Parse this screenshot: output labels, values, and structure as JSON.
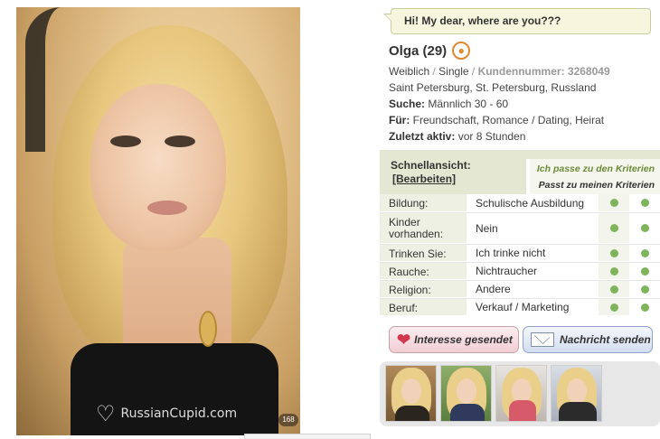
{
  "message": {
    "text": "Hi! My dear, where are you???"
  },
  "profile": {
    "name": "Olga (29)",
    "gender": "Weiblich",
    "separator": "/",
    "status": "Single",
    "customer_number_label": "Kundennummer:",
    "customer_number": "3268049",
    "location": "Saint Petersburg, St. Petersburg, Russland",
    "search_label": "Suche:",
    "search_value": "Männlich 30 - 60",
    "for_label": "Für:",
    "for_value": "Freundschaft, Romance / Dating, Heirat",
    "last_active_label": "Zuletzt aktiv:",
    "last_active_value": "vor 8 Stunden"
  },
  "photo": {
    "watermark": "RussianCupid.com",
    "photo_count": "168"
  },
  "quick_view": {
    "title": "Schnellansicht:",
    "edit_label": "[Bearbeiten]",
    "legend_match_me": "Ich passe zu den Kriterien",
    "legend_match_mine": "Passt zu meinen Kriterien",
    "rows": [
      {
        "label": "Bildung:",
        "value": "Schulische Ausbildung"
      },
      {
        "label": "Kinder vorhanden:",
        "value": "Nein"
      },
      {
        "label": "Trinken Sie:",
        "value": "Ich trinke nicht"
      },
      {
        "label": "Rauche:",
        "value": "Nichtraucher"
      },
      {
        "label": "Religion:",
        "value": "Andere"
      },
      {
        "label": "Beruf:",
        "value": "Verkauf / Marketing"
      }
    ],
    "match_color": "#7fb55a"
  },
  "actions": {
    "interest_label": "Interesse gesendet",
    "message_label": "Nachricht senden"
  },
  "icons": {
    "profile": "person-circle-icon",
    "heart": "heart-icon",
    "envelope": "envelope-icon"
  },
  "colors": {
    "accent_green": "#6b8a37",
    "quickview_bg": "#e4e8d2",
    "profile_icon": "#e08a2c"
  }
}
